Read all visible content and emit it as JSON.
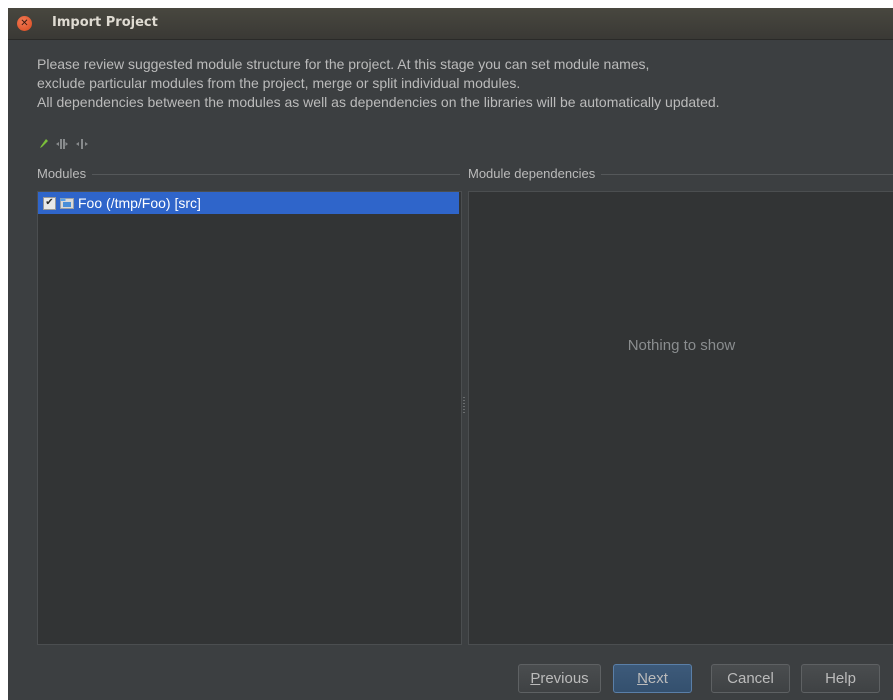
{
  "window": {
    "title": "Import Project"
  },
  "description": {
    "line1": "Please review suggested module structure for the project. At this stage you can set module names,",
    "line2": "exclude particular modules from the project, merge or split individual modules.",
    "line3": "All dependencies between the modules as well as dependencies on the libraries will be automatically updated."
  },
  "toolbar": {
    "icons": [
      "rename-icon",
      "merge-modules-icon",
      "split-module-icon"
    ]
  },
  "modules": {
    "label": "Modules",
    "items": [
      {
        "label": "Foo (/tmp/Foo) [src]",
        "checked": true,
        "selected": true
      }
    ]
  },
  "dependencies": {
    "label": "Module dependencies",
    "empty_text": "Nothing to show"
  },
  "buttons": {
    "previous": {
      "mnemonic": "P",
      "rest": "revious"
    },
    "next": {
      "mnemonic": "N",
      "rest": "ext"
    },
    "cancel": "Cancel",
    "help": "Help"
  },
  "colors": {
    "background": "#3c3f41",
    "panel": "#323435",
    "selection": "#2f65ca",
    "close": "#e25b2c",
    "rename_icon": "#7bbf3a"
  }
}
